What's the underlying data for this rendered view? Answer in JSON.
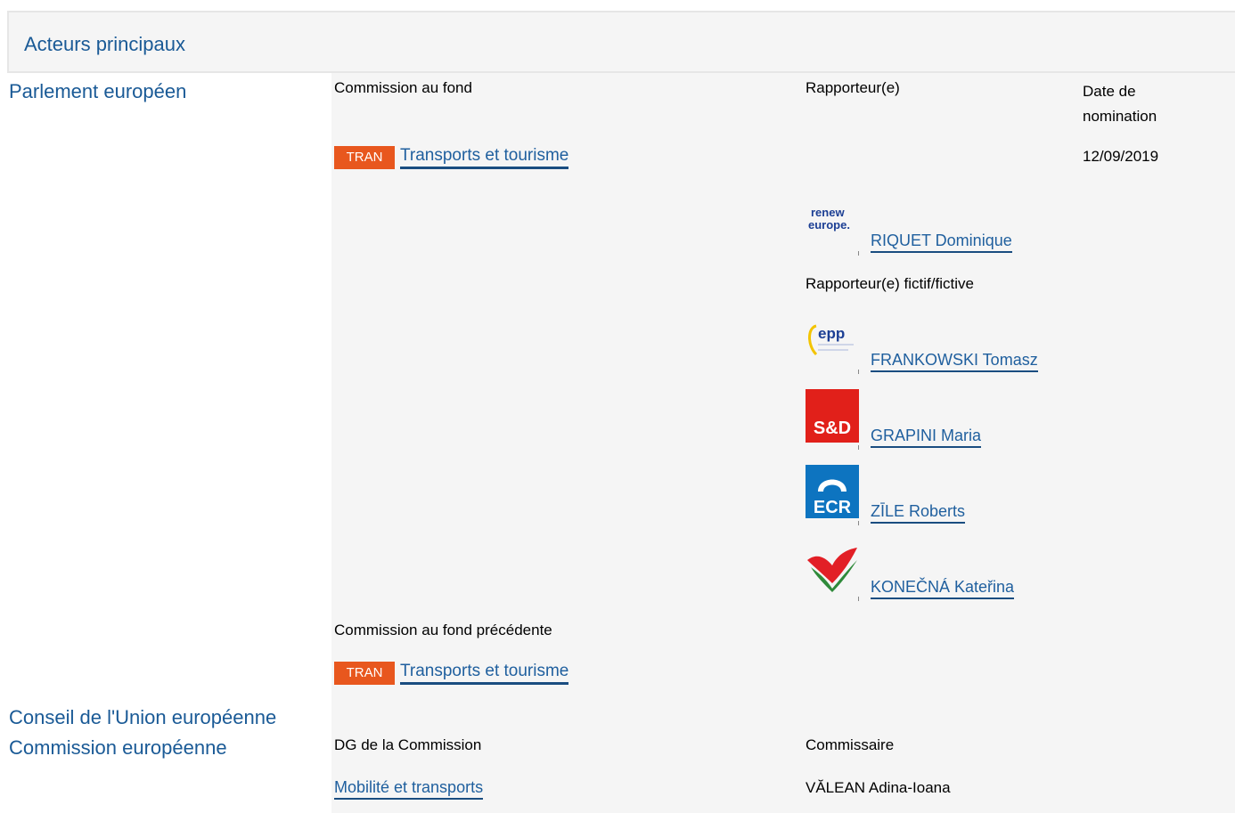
{
  "header": {
    "title": "Acteurs principaux"
  },
  "parliament": {
    "label": "Parlement européen",
    "col_committee": "Commission au fond",
    "col_rapporteur": "Rapporteur(e)",
    "col_date": "Date de nomination",
    "committee": {
      "badge": "TRAN",
      "name": "Transports et tourisme",
      "date": "12/09/2019"
    },
    "rapporteur": {
      "group_logo": "renew-europe-logo",
      "logo_text_1": "renew",
      "logo_text_2": "europe.",
      "name": "RIQUET Dominique"
    },
    "shadow_label": "Rapporteur(e) fictif/fictive",
    "shadows": [
      {
        "group_logo": "epp-logo",
        "logo_text": "epp",
        "name": "FRANKOWSKI Tomasz"
      },
      {
        "group_logo": "sd-logo",
        "logo_text": "S&D",
        "name": "GRAPINI Maria"
      },
      {
        "group_logo": "ecr-logo",
        "logo_text": "ECR",
        "name": "ZĪLE Roberts"
      },
      {
        "group_logo": "gue-ngl-logo",
        "name": "KONEČNÁ Kateřina"
      }
    ],
    "previous_label": "Commission au fond précédente",
    "previous_committee": {
      "badge": "TRAN",
      "name": "Transports et tourisme"
    }
  },
  "council": {
    "label": "Conseil de l'Union européenne"
  },
  "commission": {
    "label": "Commission européenne",
    "col_dg": "DG de la Commission",
    "col_commissioner": "Commissaire",
    "dg": "Mobilité et transports",
    "commissioner": "VĂLEAN Adina-Ioana"
  },
  "colors": {
    "link": "#1f5f9e",
    "badge": "#e8571e",
    "panel": "#f5f5f5"
  }
}
